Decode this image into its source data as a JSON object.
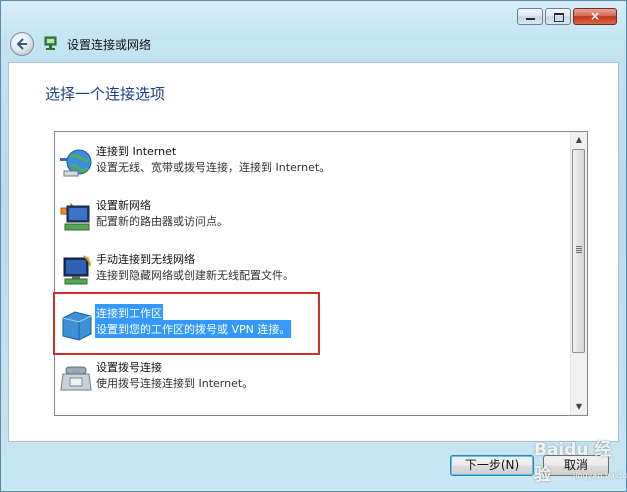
{
  "window": {
    "title": "设置连接或网络",
    "controls": {
      "minimize": "minimize-icon",
      "maximize": "maximize-icon",
      "close_glyph": "×"
    }
  },
  "heading": "选择一个连接选项",
  "options": [
    {
      "title": "连接到 Internet",
      "desc": "设置无线、宽带或拨号连接，连接到 Internet。",
      "icon": "globe-network-icon"
    },
    {
      "title": "设置新网络",
      "desc": "配置新的路由器或访问点。",
      "icon": "router-icon"
    },
    {
      "title": "手动连接到无线网络",
      "desc": "连接到隐藏网络或创建新无线配置文件。",
      "icon": "wireless-monitor-icon"
    },
    {
      "title": "连接到工作区",
      "desc": "设置到您的工作区的拨号或 VPN 连接。",
      "icon": "workplace-icon",
      "selected": true
    },
    {
      "title": "设置拨号连接",
      "desc": "使用拨号连接连接到 Internet。",
      "icon": "phone-modem-icon"
    }
  ],
  "buttons": {
    "next": "下一步(N)",
    "cancel": "取消"
  },
  "watermark": {
    "text": "Baidu 经验",
    "sub": "jingyan.baidu.com"
  },
  "colors": {
    "selection": "#3399ff",
    "heading": "#1f3f8c",
    "highlight_border": "#d12c2c"
  }
}
